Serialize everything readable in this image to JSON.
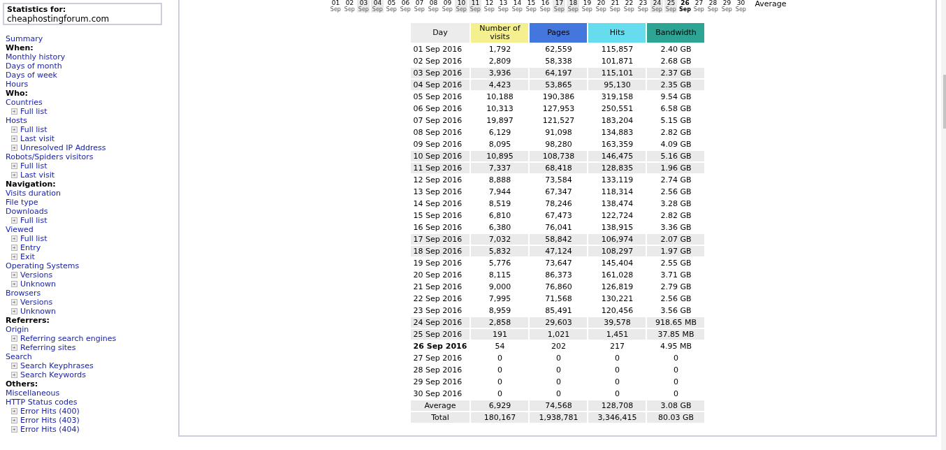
{
  "sidebar": {
    "stats_box": {
      "label": "Statistics for:",
      "site": "cheaphostingforum.com"
    },
    "menu": [
      {
        "kind": "link",
        "label": "Summary"
      },
      {
        "kind": "heading",
        "label": "When:"
      },
      {
        "kind": "link",
        "label": "Monthly history"
      },
      {
        "kind": "link",
        "label": "Days of month"
      },
      {
        "kind": "link",
        "label": "Days of week"
      },
      {
        "kind": "link",
        "label": "Hours"
      },
      {
        "kind": "heading",
        "label": "Who:"
      },
      {
        "kind": "link",
        "label": "Countries",
        "children": [
          {
            "label": "Full list"
          }
        ]
      },
      {
        "kind": "link",
        "label": "Hosts",
        "children": [
          {
            "label": "Full list"
          },
          {
            "label": "Last visit"
          },
          {
            "label": "Unresolved IP Address"
          }
        ]
      },
      {
        "kind": "link",
        "label": "Robots/Spiders visitors",
        "children": [
          {
            "label": "Full list"
          },
          {
            "label": "Last visit"
          }
        ]
      },
      {
        "kind": "heading",
        "label": "Navigation:"
      },
      {
        "kind": "link",
        "label": "Visits duration"
      },
      {
        "kind": "link",
        "label": "File type"
      },
      {
        "kind": "link",
        "label": "Downloads",
        "children": [
          {
            "label": "Full list"
          }
        ]
      },
      {
        "kind": "link",
        "label": "Viewed",
        "children": [
          {
            "label": "Full list"
          },
          {
            "label": "Entry"
          },
          {
            "label": "Exit"
          }
        ]
      },
      {
        "kind": "link",
        "label": "Operating Systems",
        "children": [
          {
            "label": "Versions"
          },
          {
            "label": "Unknown"
          }
        ]
      },
      {
        "kind": "link",
        "label": "Browsers",
        "children": [
          {
            "label": "Versions"
          },
          {
            "label": "Unknown"
          }
        ]
      },
      {
        "kind": "heading",
        "label": "Referrers:"
      },
      {
        "kind": "link",
        "label": "Origin",
        "children": [
          {
            "label": "Referring search engines"
          },
          {
            "label": "Referring sites"
          }
        ]
      },
      {
        "kind": "link",
        "label": "Search",
        "children": [
          {
            "label": "Search Keyphrases"
          },
          {
            "label": "Search Keywords"
          }
        ]
      },
      {
        "kind": "heading",
        "label": "Others:"
      },
      {
        "kind": "link",
        "label": "Miscellaneous"
      },
      {
        "kind": "link",
        "label": "HTTP Status codes",
        "children": [
          {
            "label": "Error Hits (400)"
          },
          {
            "label": "Error Hits (403)"
          },
          {
            "label": "Error Hits (404)"
          }
        ]
      }
    ]
  },
  "days_chart": {
    "days": [
      {
        "number": "01",
        "month": "Sep",
        "weekend": false,
        "today": false
      },
      {
        "number": "02",
        "month": "Sep",
        "weekend": false,
        "today": false
      },
      {
        "number": "03",
        "month": "Sep",
        "weekend": true,
        "today": false
      },
      {
        "number": "04",
        "month": "Sep",
        "weekend": true,
        "today": false
      },
      {
        "number": "05",
        "month": "Sep",
        "weekend": false,
        "today": false
      },
      {
        "number": "06",
        "month": "Sep",
        "weekend": false,
        "today": false
      },
      {
        "number": "07",
        "month": "Sep",
        "weekend": false,
        "today": false
      },
      {
        "number": "08",
        "month": "Sep",
        "weekend": false,
        "today": false
      },
      {
        "number": "09",
        "month": "Sep",
        "weekend": false,
        "today": false
      },
      {
        "number": "10",
        "month": "Sep",
        "weekend": true,
        "today": false
      },
      {
        "number": "11",
        "month": "Sep",
        "weekend": true,
        "today": false
      },
      {
        "number": "12",
        "month": "Sep",
        "weekend": false,
        "today": false
      },
      {
        "number": "13",
        "month": "Sep",
        "weekend": false,
        "today": false
      },
      {
        "number": "14",
        "month": "Sep",
        "weekend": false,
        "today": false
      },
      {
        "number": "15",
        "month": "Sep",
        "weekend": false,
        "today": false
      },
      {
        "number": "16",
        "month": "Sep",
        "weekend": false,
        "today": false
      },
      {
        "number": "17",
        "month": "Sep",
        "weekend": true,
        "today": false
      },
      {
        "number": "18",
        "month": "Sep",
        "weekend": true,
        "today": false
      },
      {
        "number": "19",
        "month": "Sep",
        "weekend": false,
        "today": false
      },
      {
        "number": "20",
        "month": "Sep",
        "weekend": false,
        "today": false
      },
      {
        "number": "21",
        "month": "Sep",
        "weekend": false,
        "today": false
      },
      {
        "number": "22",
        "month": "Sep",
        "weekend": false,
        "today": false
      },
      {
        "number": "23",
        "month": "Sep",
        "weekend": false,
        "today": false
      },
      {
        "number": "24",
        "month": "Sep",
        "weekend": true,
        "today": false
      },
      {
        "number": "25",
        "month": "Sep",
        "weekend": true,
        "today": false
      },
      {
        "number": "26",
        "month": "Sep",
        "weekend": false,
        "today": true
      },
      {
        "number": "27",
        "month": "Sep",
        "weekend": false,
        "today": false
      },
      {
        "number": "28",
        "month": "Sep",
        "weekend": false,
        "today": false
      },
      {
        "number": "29",
        "month": "Sep",
        "weekend": false,
        "today": false
      },
      {
        "number": "30",
        "month": "Sep",
        "weekend": false,
        "today": false
      }
    ],
    "average_label": "Average"
  },
  "table": {
    "columns": [
      {
        "label": "Day",
        "color": "#ececec"
      },
      {
        "label": "Number of visits",
        "color": "#f4f090"
      },
      {
        "label": "Pages",
        "color": "#4477dd"
      },
      {
        "label": "Hits",
        "color": "#66ddee"
      },
      {
        "label": "Bandwidth",
        "color": "#2ea495"
      }
    ],
    "rows": [
      {
        "cells": [
          "01 Sep 2016",
          "1,792",
          "62,559",
          "115,857",
          "2.40 GB"
        ],
        "weekend": false,
        "today": false
      },
      {
        "cells": [
          "02 Sep 2016",
          "2,809",
          "58,338",
          "101,871",
          "2.68 GB"
        ],
        "weekend": false,
        "today": false
      },
      {
        "cells": [
          "03 Sep 2016",
          "3,936",
          "64,197",
          "115,101",
          "2.37 GB"
        ],
        "weekend": true,
        "today": false
      },
      {
        "cells": [
          "04 Sep 2016",
          "4,423",
          "53,865",
          "95,130",
          "2.35 GB"
        ],
        "weekend": true,
        "today": false
      },
      {
        "cells": [
          "05 Sep 2016",
          "10,188",
          "190,386",
          "319,158",
          "9.54 GB"
        ],
        "weekend": false,
        "today": false
      },
      {
        "cells": [
          "06 Sep 2016",
          "10,313",
          "127,953",
          "250,551",
          "6.58 GB"
        ],
        "weekend": false,
        "today": false
      },
      {
        "cells": [
          "07 Sep 2016",
          "19,897",
          "121,527",
          "183,204",
          "5.15 GB"
        ],
        "weekend": false,
        "today": false
      },
      {
        "cells": [
          "08 Sep 2016",
          "6,129",
          "91,098",
          "134,883",
          "2.82 GB"
        ],
        "weekend": false,
        "today": false
      },
      {
        "cells": [
          "09 Sep 2016",
          "8,095",
          "98,280",
          "163,359",
          "4.09 GB"
        ],
        "weekend": false,
        "today": false
      },
      {
        "cells": [
          "10 Sep 2016",
          "10,895",
          "108,738",
          "146,475",
          "5.16 GB"
        ],
        "weekend": true,
        "today": false
      },
      {
        "cells": [
          "11 Sep 2016",
          "7,337",
          "68,418",
          "128,835",
          "1.96 GB"
        ],
        "weekend": true,
        "today": false
      },
      {
        "cells": [
          "12 Sep 2016",
          "8,888",
          "73,584",
          "133,119",
          "2.74 GB"
        ],
        "weekend": false,
        "today": false
      },
      {
        "cells": [
          "13 Sep 2016",
          "7,944",
          "67,347",
          "118,314",
          "2.56 GB"
        ],
        "weekend": false,
        "today": false
      },
      {
        "cells": [
          "14 Sep 2016",
          "8,519",
          "78,246",
          "138,474",
          "3.28 GB"
        ],
        "weekend": false,
        "today": false
      },
      {
        "cells": [
          "15 Sep 2016",
          "6,810",
          "67,473",
          "122,724",
          "2.82 GB"
        ],
        "weekend": false,
        "today": false
      },
      {
        "cells": [
          "16 Sep 2016",
          "6,380",
          "76,041",
          "138,915",
          "3.36 GB"
        ],
        "weekend": false,
        "today": false
      },
      {
        "cells": [
          "17 Sep 2016",
          "7,032",
          "58,842",
          "106,974",
          "2.07 GB"
        ],
        "weekend": true,
        "today": false
      },
      {
        "cells": [
          "18 Sep 2016",
          "5,832",
          "47,124",
          "108,297",
          "1.97 GB"
        ],
        "weekend": true,
        "today": false
      },
      {
        "cells": [
          "19 Sep 2016",
          "5,776",
          "73,647",
          "145,404",
          "2.55 GB"
        ],
        "weekend": false,
        "today": false
      },
      {
        "cells": [
          "20 Sep 2016",
          "8,115",
          "86,373",
          "161,028",
          "3.71 GB"
        ],
        "weekend": false,
        "today": false
      },
      {
        "cells": [
          "21 Sep 2016",
          "9,000",
          "76,860",
          "126,819",
          "2.79 GB"
        ],
        "weekend": false,
        "today": false
      },
      {
        "cells": [
          "22 Sep 2016",
          "7,995",
          "71,568",
          "130,221",
          "2.56 GB"
        ],
        "weekend": false,
        "today": false
      },
      {
        "cells": [
          "23 Sep 2016",
          "8,959",
          "85,491",
          "120,456",
          "3.56 GB"
        ],
        "weekend": false,
        "today": false
      },
      {
        "cells": [
          "24 Sep 2016",
          "2,858",
          "29,603",
          "39,578",
          "918.65 MB"
        ],
        "weekend": true,
        "today": false
      },
      {
        "cells": [
          "25 Sep 2016",
          "191",
          "1,021",
          "1,451",
          "37.85 MB"
        ],
        "weekend": true,
        "today": false
      },
      {
        "cells": [
          "26 Sep 2016",
          "54",
          "202",
          "217",
          "4.95 MB"
        ],
        "weekend": false,
        "today": true
      },
      {
        "cells": [
          "27 Sep 2016",
          "0",
          "0",
          "0",
          "0"
        ],
        "weekend": false,
        "today": false
      },
      {
        "cells": [
          "28 Sep 2016",
          "0",
          "0",
          "0",
          "0"
        ],
        "weekend": false,
        "today": false
      },
      {
        "cells": [
          "29 Sep 2016",
          "0",
          "0",
          "0",
          "0"
        ],
        "weekend": false,
        "today": false
      },
      {
        "cells": [
          "30 Sep 2016",
          "0",
          "0",
          "0",
          "0"
        ],
        "weekend": false,
        "today": false
      }
    ],
    "summary_rows": [
      {
        "cells": [
          "Average",
          "6,929",
          "74,568",
          "128,708",
          "3.08 GB"
        ]
      },
      {
        "cells": [
          "Total",
          "180,167",
          "1,938,781",
          "3,346,415",
          "80.03 GB"
        ]
      }
    ]
  }
}
